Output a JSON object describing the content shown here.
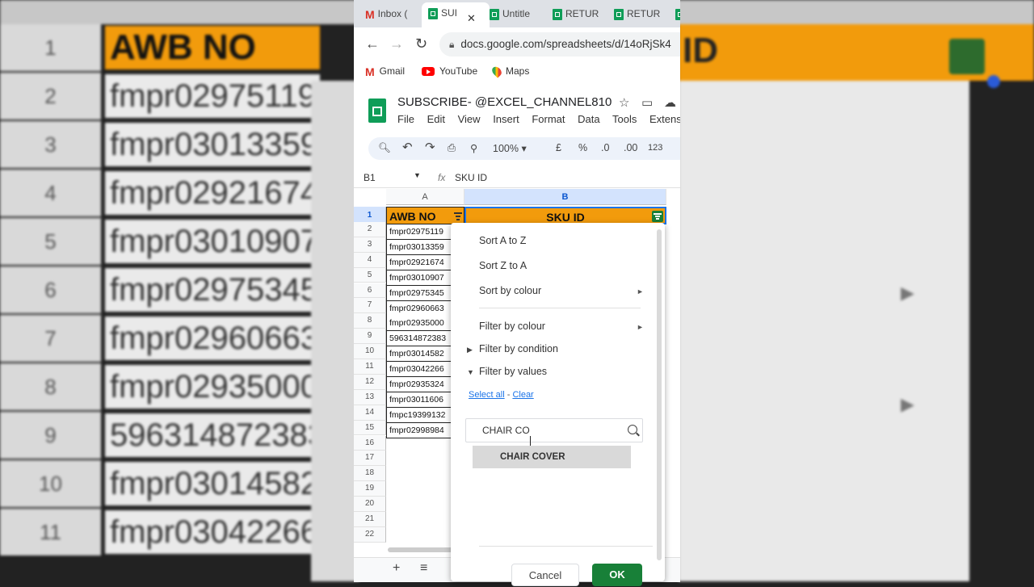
{
  "background": {
    "row_numbers": [
      "1",
      "2",
      "3",
      "4",
      "5",
      "6",
      "7",
      "8",
      "9",
      "10",
      "11"
    ],
    "cells": [
      "AWB NO",
      "fmpr02975119",
      "fmpr03013359",
      "fmpr02921674",
      "fmpr03010907",
      "fmpr02975345",
      "fmpr02960663",
      "fmpr02935000",
      "596314872383",
      "fmpr03014582",
      "fmpr03042266"
    ],
    "right_header": "ID"
  },
  "browser": {
    "tabs": [
      {
        "label": "Inbox (",
        "icon": "gmail-icon"
      },
      {
        "label": "SUI",
        "icon": "sheets-icon",
        "close": "✕"
      },
      {
        "label": "Untitle",
        "icon": "sheets-icon"
      },
      {
        "label": "RETUR",
        "icon": "sheets-icon"
      },
      {
        "label": "RETUR",
        "icon": "sheets-icon"
      }
    ],
    "url": "docs.google.com/spreadsheets/d/14oRjSk4",
    "bookmarks": [
      {
        "label": "Gmail",
        "icon": "gmail-icon"
      },
      {
        "label": "YouTube",
        "icon": "youtube-icon"
      },
      {
        "label": "Maps",
        "icon": "maps-icon"
      }
    ]
  },
  "doc": {
    "title": "SUBSCRIBE- @EXCEL_CHANNEL810",
    "menu": [
      "File",
      "Edit",
      "View",
      "Insert",
      "Format",
      "Data",
      "Tools",
      "Extensio"
    ]
  },
  "toolbar": {
    "zoom": "100%",
    "currency": "£",
    "percent": "%",
    "dec_less": ".0",
    "dec_more": ".00",
    "number_format": "123"
  },
  "formula_bar": {
    "cell_ref": "B1",
    "fx": "fx",
    "content": "SKU ID"
  },
  "grid": {
    "col_headers": [
      "A",
      "B"
    ],
    "rows": [
      "1",
      "2",
      "3",
      "4",
      "5",
      "6",
      "7",
      "8",
      "9",
      "10",
      "11",
      "12",
      "13",
      "14",
      "15",
      "16",
      "17",
      "18",
      "19",
      "20",
      "21",
      "22"
    ],
    "header_a": "AWB NO",
    "header_b": "SKU ID",
    "col_a_values": [
      "fmpr02975119",
      "fmpr03013359",
      "fmpr02921674",
      "fmpr03010907",
      "fmpr02975345",
      "fmpr02960663",
      "fmpr02935000",
      "596314872383",
      "fmpr03014582",
      "fmpr03042266",
      "fmpr02935324",
      "fmpr03011606",
      "fmpc19399132",
      "fmpr02998984"
    ]
  },
  "filter_menu": {
    "sort_az": "Sort A to Z",
    "sort_za": "Sort Z to A",
    "sort_colour": "Sort by colour",
    "filter_colour": "Filter by colour",
    "filter_condition": "Filter by condition",
    "filter_values": "Filter by values",
    "select_all": "Select all",
    "sep": "-",
    "clear": "Clear",
    "search_value": "CHAIR CO",
    "suggestion": "CHAIR COVER",
    "cancel": "Cancel",
    "ok": "OK"
  },
  "colors": {
    "header_orange": "#f29b0c",
    "sheets_green": "#0f9d58",
    "ok_green": "#188038",
    "link_blue": "#1a73e8"
  }
}
